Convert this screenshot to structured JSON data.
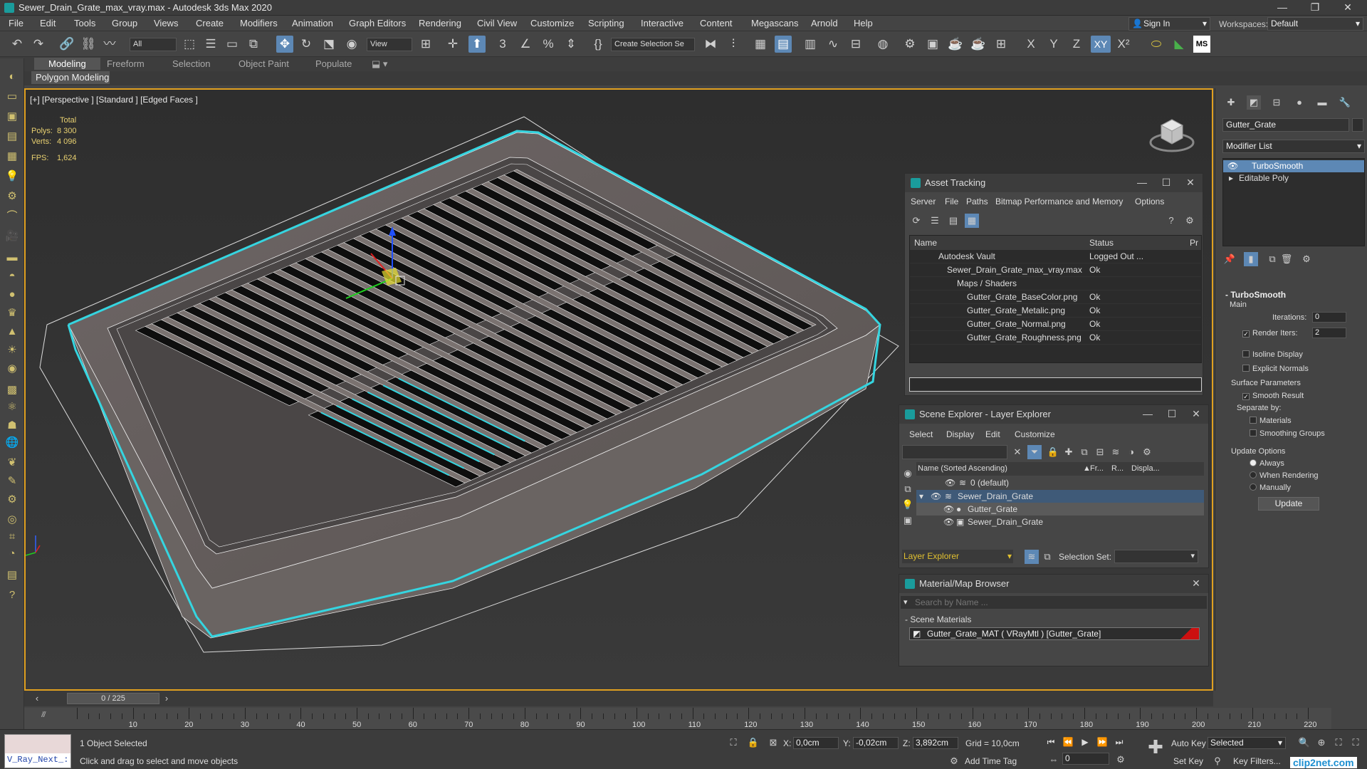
{
  "title_bar": {
    "title": "Sewer_Drain_Grate_max_vray.max - Autodesk 3ds Max 2020"
  },
  "menu": [
    "File",
    "Edit",
    "Tools",
    "Group",
    "Views",
    "Create",
    "Modifiers",
    "Animation",
    "Graph Editors",
    "Rendering",
    "Civil View",
    "Customize",
    "Scripting",
    "Interactive",
    "Content",
    "Megascans",
    "Arnold",
    "Help"
  ],
  "account": {
    "signin": "Sign In",
    "workspaces_label": "Workspaces:",
    "workspace": "Default"
  },
  "toolbar": {
    "filter": "All",
    "refcoord": "View",
    "selection_set": "Create Selection Se",
    "axis_x": "X",
    "axis_y": "Y",
    "axis_z": "Z",
    "axis_xy": "XY"
  },
  "ribbon": {
    "tabs": [
      "Modeling",
      "Freeform",
      "Selection",
      "Object Paint",
      "Populate"
    ],
    "sub": "Polygon Modeling"
  },
  "viewport": {
    "label": "[+] [Perspective ] [Standard ] [Edged Faces ]",
    "stats_total": "Total",
    "polys_label": "Polys:",
    "polys": "8 300",
    "verts_label": "Verts:",
    "verts": "4 096",
    "fps_label": "FPS:",
    "fps": "1,624"
  },
  "asset_tracking": {
    "title": "Asset Tracking",
    "menu": [
      "Server",
      "File",
      "Paths",
      "Bitmap Performance and Memory",
      "Options"
    ],
    "col_name": "Name",
    "col_status": "Status",
    "col_pr": "Pr",
    "rows": [
      {
        "name": "Autodesk Vault",
        "status": "Logged Out ..."
      },
      {
        "name": "Sewer_Drain_Grate_max_vray.max",
        "status": "Ok"
      },
      {
        "name": "Maps / Shaders",
        "status": ""
      },
      {
        "name": "Gutter_Grate_BaseColor.png",
        "status": "Ok"
      },
      {
        "name": "Gutter_Grate_Metalic.png",
        "status": "Ok"
      },
      {
        "name": "Gutter_Grate_Normal.png",
        "status": "Ok"
      },
      {
        "name": "Gutter_Grate_Roughness.png",
        "status": "Ok"
      }
    ]
  },
  "scene_explorer": {
    "title": "Scene Explorer - Layer Explorer",
    "menu": [
      "Select",
      "Display",
      "Edit",
      "Customize"
    ],
    "col_name": "Name (Sorted Ascending)",
    "col_fr": "Fr...",
    "col_r": "R...",
    "col_disp": "Displa...",
    "rows": [
      {
        "name": "0 (default)"
      },
      {
        "name": "Sewer_Drain_Grate"
      },
      {
        "name": "Gutter_Grate"
      },
      {
        "name": "Sewer_Drain_Grate"
      }
    ],
    "footer_mode": "Layer Explorer",
    "selection_set_label": "Selection Set:"
  },
  "material_browser": {
    "title": "Material/Map Browser",
    "search_placeholder": "Search by Name ...",
    "section": "- Scene Materials",
    "material": "Gutter_Grate_MAT ( VRayMtl ) [Gutter_Grate]"
  },
  "command_panel": {
    "object_name": "Gutter_Grate",
    "modifier_list": "Modifier List",
    "stack": [
      "TurboSmooth",
      "Editable Poly"
    ],
    "rollout": "TurboSmooth",
    "main": "Main",
    "iterations_label": "Iterations:",
    "iterations": "0",
    "render_iters_label": "Render Iters:",
    "render_iters": "2",
    "isoline": "Isoline Display",
    "explicit": "Explicit Normals",
    "surface_params": "Surface Parameters",
    "smooth_result": "Smooth Result",
    "separate_by": "Separate by:",
    "materials": "Materials",
    "smoothing_groups": "Smoothing Groups",
    "update_options": "Update Options",
    "always": "Always",
    "when_rendering": "When Rendering",
    "manually": "Manually",
    "update_btn": "Update"
  },
  "timeline": {
    "frame": "0 / 225",
    "ticks": [
      "10",
      "20",
      "30",
      "40",
      "50",
      "60",
      "70",
      "80",
      "90",
      "100",
      "110",
      "120",
      "130",
      "140",
      "150",
      "160",
      "170",
      "180",
      "190",
      "200",
      "210",
      "220"
    ]
  },
  "status_bar": {
    "maxscript": "V_Ray_Next_:",
    "selected": "1 Object Selected",
    "prompt": "Click and drag to select and move objects",
    "x_label": "X:",
    "x": "0,0cm",
    "y_label": "Y:",
    "y": "-0,02cm",
    "z_label": "Z:",
    "z": "3,892cm",
    "grid": "Grid = 10,0cm",
    "add_time_tag": "Add Time Tag",
    "auto_key": "Auto Key",
    "set_key": "Set Key",
    "key_mode": "Selected",
    "key_filters": "Key Filters...",
    "frame_field": "0",
    "watermark": "clip2net.com"
  }
}
